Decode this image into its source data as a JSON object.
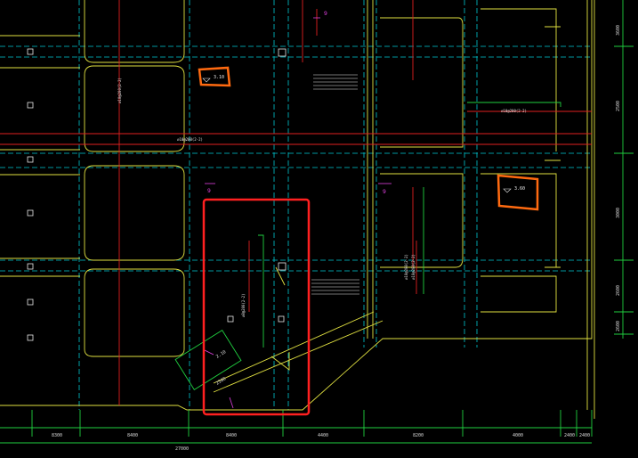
{
  "drawing": {
    "colors": {
      "background": "#000000",
      "axis": "#00c8d2",
      "wall": "#e0e040",
      "beam_red": "#e02020",
      "green": "#20d040",
      "magenta": "#e040e0",
      "orange": "#ff6a10",
      "white": "#e8e8e8",
      "highlight": "#ff2020"
    },
    "level_tags": [
      {
        "id": "left",
        "text": "3.10"
      },
      {
        "id": "right",
        "text": "3.60"
      }
    ],
    "section_marks": [
      "9",
      "9",
      "9"
    ],
    "rebar_notes": [
      "⌀10@200(2-2)",
      "⌀10@200(2-2)",
      "⌀10@200(2-2)",
      "⌀8@200(2-2)",
      "⌀10@200(2-2)",
      "⌀10@200(2-2)"
    ],
    "dimension_labels_bottom": [
      "8300",
      "8400",
      "8400",
      "4400",
      "8200",
      "4000",
      "2400",
      "2400"
    ],
    "dimension_total": "27000",
    "dimension_labels_right": [
      "3600",
      "2500",
      "3000",
      "2600",
      "2600"
    ],
    "ramp_labels": [
      "2.10",
      "2500"
    ]
  }
}
